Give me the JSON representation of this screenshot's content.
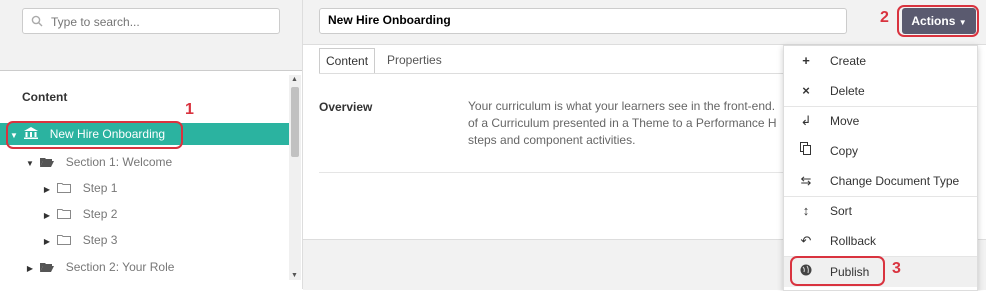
{
  "search": {
    "placeholder": "Type to search..."
  },
  "tree": {
    "title": "Content",
    "root": "New Hire Onboarding",
    "section1": "Section 1: Welcome",
    "steps": [
      "Step 1",
      "Step 2",
      "Step 3"
    ],
    "section2": "Section 2: Your Role"
  },
  "document": {
    "name": "New Hire Onboarding"
  },
  "actions_label": "Actions",
  "tabs": [
    "Content",
    "Properties"
  ],
  "overview": {
    "label": "Overview",
    "text": [
      "Your curriculum is what your learners see in the front-end.",
      "of a Curriculum presented in a Theme to a Performance H",
      "steps and component activities."
    ]
  },
  "menu": [
    "Create",
    "Delete",
    "Move",
    "Copy",
    "Change Document Type",
    "Sort",
    "Rollback",
    "Publish"
  ],
  "annotations": [
    "1",
    "2",
    "3"
  ],
  "colors": {
    "accent": "#2bb3a0",
    "highlight": "#d9333f",
    "actions_button": "#5a5a6f"
  }
}
